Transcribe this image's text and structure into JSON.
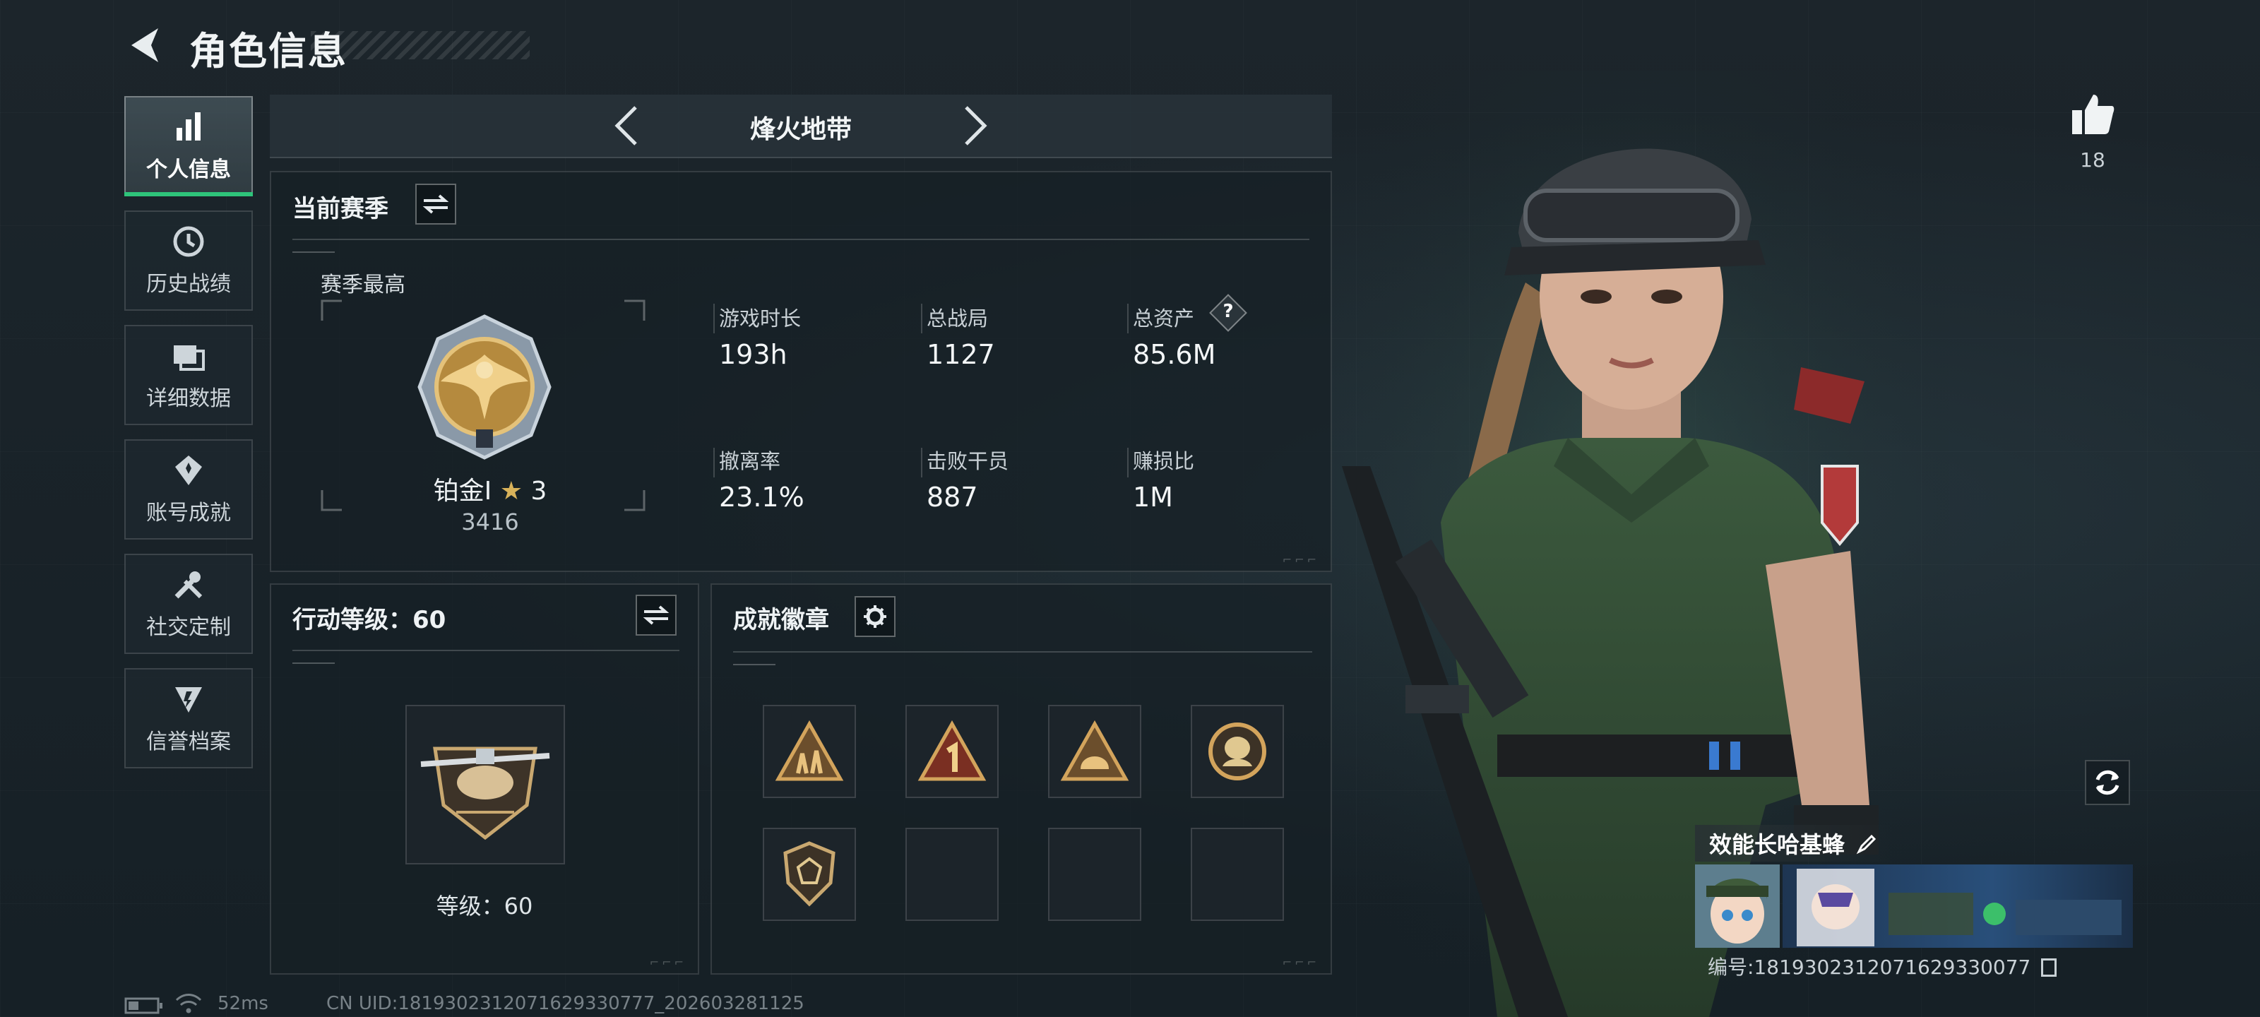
{
  "header": {
    "title": "角色信息"
  },
  "sidebar": {
    "items": [
      {
        "label": "个人信息",
        "icon": "bar-chart-icon",
        "active": true
      },
      {
        "label": "历史战绩",
        "icon": "history-icon",
        "active": false
      },
      {
        "label": "详细数据",
        "icon": "cards-icon",
        "active": false
      },
      {
        "label": "账号成就",
        "icon": "achievement-icon",
        "active": false
      },
      {
        "label": "社交定制",
        "icon": "tools-icon",
        "active": false
      },
      {
        "label": "信誉档案",
        "icon": "credit-icon",
        "active": false
      }
    ]
  },
  "mode": {
    "name": "烽火地带"
  },
  "season": {
    "title": "当前赛季",
    "best_label": "赛季最高",
    "rank_name": "铂金Ⅰ",
    "rank_stars": "3",
    "rank_score": "3416",
    "stats": [
      {
        "label": "游戏时长",
        "value": "193h"
      },
      {
        "label": "总战局",
        "value": "1127"
      },
      {
        "label": "总资产",
        "value": "85.6M",
        "help": "?"
      },
      {
        "label": "撤离率",
        "value": "23.1%"
      },
      {
        "label": "击败干员",
        "value": "887"
      },
      {
        "label": "赚损比",
        "value": "1M"
      }
    ]
  },
  "action_level": {
    "title": "行动等级：60",
    "level_text": "等级：60"
  },
  "achievements": {
    "title": "成就徽章",
    "badges": [
      "triangle-soldiers-badge-icon",
      "triangle-number-one-badge-icon",
      "triangle-helmet-badge-icon",
      "round-bust-badge-icon",
      "shield-badge-icon",
      "",
      "",
      ""
    ]
  },
  "likes": {
    "count": "18"
  },
  "profile": {
    "nickname": "效能长哈基蜂",
    "id_line": "编号:1819302312071629330077"
  },
  "status_bar": {
    "ping": "52ms",
    "uid": "CN UID:1819302312071629330777_202603281125"
  },
  "colors": {
    "accent_green": "#2ec47a",
    "panel_bg": "#162026"
  }
}
